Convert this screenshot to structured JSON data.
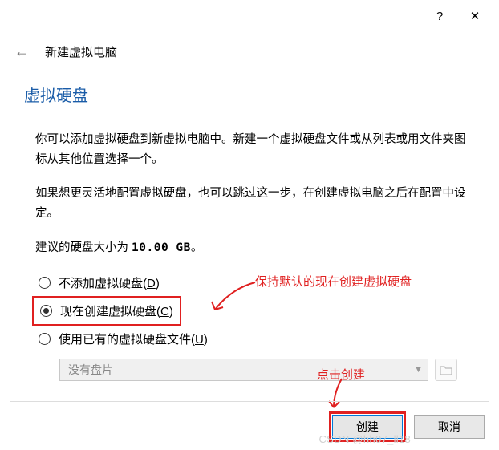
{
  "titlebar": {
    "help": "?",
    "close": "✕"
  },
  "header": {
    "wizard_title": "新建虚拟电脑"
  },
  "section": {
    "heading": "虚拟硬盘",
    "p1": "你可以添加虚拟硬盘到新虚拟电脑中。新建一个虚拟硬盘文件或从列表或用文件夹图标从其他位置选择一个。",
    "p2": "如果想更灵活地配置虚拟硬盘，也可以跳过这一步，在创建虚拟电脑之后在配置中设定。",
    "size_prefix": "建议的硬盘大小为 ",
    "size_value": "10.00 GB",
    "size_suffix": "。"
  },
  "radio": {
    "opt1": {
      "label": "不添加虚拟硬盘(",
      "mk": "D",
      "tail": ")"
    },
    "opt2": {
      "label": "现在创建虚拟硬盘(",
      "mk": "C",
      "tail": ")"
    },
    "opt3": {
      "label": "使用已有的虚拟硬盘文件(",
      "mk": "U",
      "tail": ")"
    }
  },
  "dropdown": {
    "placeholder": "没有盘片"
  },
  "annotations": {
    "a1": "保持默认的现在创建虚拟硬盘",
    "a2": "点击创建"
  },
  "footer": {
    "create": "创建",
    "cancel": "取消"
  },
  "watermark": "CSDN @hh07_ll18"
}
